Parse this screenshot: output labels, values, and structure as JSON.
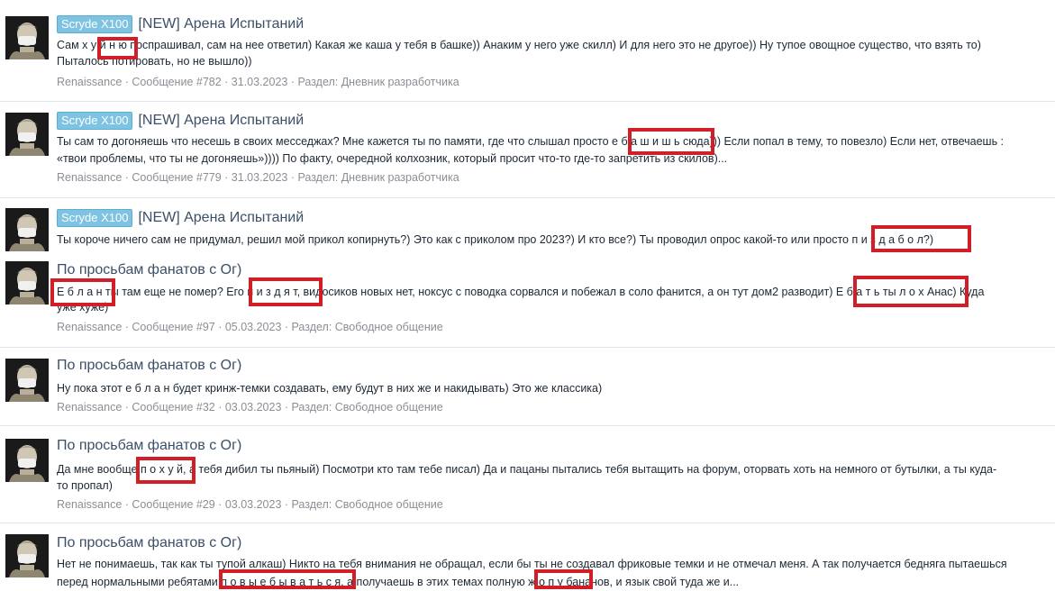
{
  "results": [
    {
      "prefix": "Scryde X100",
      "title": "[NEW] Арена Испытаний",
      "lines": [
        "Сам х у й н ю поспрашивал, сам на нее ответил) Какая же каша у тебя в башке)) Анаким у него уже скилл) И для него это не другое)) Ну тупое овощное существо, что взять то)",
        "Пыталось потировать, но не вышло))"
      ],
      "meta": "Renaissance · Сообщение #782 · 31.03.2023 · Раздел: Дневник разработчика"
    },
    {
      "prefix": "Scryde X100",
      "title": "[NEW] Арена Испытаний",
      "lines": [
        "Ты сам то догоняешь что несешь в своих месседжах? Мне кажется ты по памяти, где что слышал просто е б а ш и ш ь сюда))) Если попал в тему, то повезло) Если нет, отвечаешь :",
        "«твои проблемы, что ты не догоняешь»)))) По факту, очередной колхозник, который просит что-то где-то запретить из скилов)..."
      ],
      "meta": "Renaissance · Сообщение #779 · 31.03.2023 · Раздел: Дневник разработчика"
    },
    {
      "prefix": "Scryde X100",
      "title": "[NEW] Арена Испытаний",
      "lines": [
        "Ты короче ничего сам не придумал, решил мой прикол копирнуть?) Это как с приколом про 2023?) И кто все?) Ты проводил опрос какой-то или просто п и з д а б о л?)"
      ],
      "meta": ""
    },
    {
      "prefix": "",
      "title": "По просьбам фанатов с Ог)",
      "lines": [
        "Е б л а н ты там еще не помер? Его п и з д я т, видосиков новых нет, ноксус с поводка сорвался и побежал в соло фанится, а он тут дом2 разводит) Е б а т ь ты л о х Анас) Куда",
        "уже хуже)"
      ],
      "meta": "Renaissance · Сообщение #97 · 05.03.2023 · Раздел: Свободное общение"
    },
    {
      "prefix": "",
      "title": "По просьбам фанатов с Ог)",
      "lines": [
        "Ну пока этот е б л а н будет кринж-темки создавать, ему будут в них же и накидывать) Это же классика)"
      ],
      "meta": "Renaissance · Сообщение #32 · 03.03.2023 · Раздел: Свободное общение"
    },
    {
      "prefix": "",
      "title": "По просьбам фанатов с Ог)",
      "lines": [
        "Да мне вообще п о х у й, а тебя дибил ты пьяный) Посмотри кто там тебе писал) Да и пацаны пытались тебя вытащить на форум, оторвать хоть на немного от бутылки, а ты куда-",
        "то пропал)"
      ],
      "meta": "Renaissance · Сообщение #29 · 03.03.2023 · Раздел: Свободное общение"
    },
    {
      "prefix": "",
      "title": "По просьбам фанатов с Ог)",
      "lines": [
        "Нет не понимаешь, так как ты тупой алкаш) Никто на тебя внимания не обращал, если бы ты не создавал фриковые темки и не отмечал меня. А так получается бедняга пытаешься",
        "перед нормальными ребятами п о в ы е б ы в а т ь с я, а получаешь в этих темах полную ж о п у бананов, и язык свой туда же и..."
      ],
      "meta": ""
    }
  ],
  "colors": {
    "prefix_bg": "#7fc3e3",
    "title": "#3b4f66",
    "meta": "#8a8f95",
    "highlight_box": "#d21f27"
  },
  "icons": [
    "avatar-statue"
  ]
}
